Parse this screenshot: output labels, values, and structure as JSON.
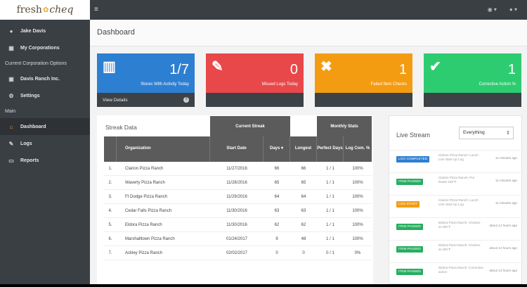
{
  "logo": {
    "fresh": "fresh",
    "cheq": "cheq"
  },
  "sidebar": {
    "user": "Jake Davis",
    "corporations": "My Corporations",
    "current_options": "Current Corporation Options",
    "corp_name": "Davis Ranch Inc.",
    "settings": "Settings",
    "main_section": "Main",
    "dashboard": "Dashboard",
    "logs": "Logs",
    "reports": "Reports"
  },
  "page": {
    "title": "Dashboard"
  },
  "cards": [
    {
      "value": "1/7",
      "label": "Stores With Activity Today",
      "footer": "View Details",
      "color": "#2d7fd1",
      "icon": "building-icon"
    },
    {
      "value": "0",
      "label": "Missed Logs Today",
      "footer": "",
      "color": "#e8484a",
      "icon": "edit-icon"
    },
    {
      "value": "1",
      "label": "Failed Item Checks",
      "footer": "",
      "color": "#f39c12",
      "icon": "times-icon"
    },
    {
      "value": "1",
      "label": "Corrective Action %",
      "footer": "",
      "color": "#2ecc71",
      "icon": "check-icon"
    }
  ],
  "streak": {
    "title": "Streak Data",
    "group_current": "Current Streak",
    "group_monthly": "Monthly Stats",
    "headers": {
      "organization": "Organization",
      "start_date": "Start Date",
      "days": "Days ▾",
      "longest": "Longest",
      "perfect_days": "Perfect Days",
      "log_com": "Log Com. %"
    },
    "rows": [
      {
        "n": "1.",
        "org": "Clarion Pizza Ranch",
        "start": "11/27/2016",
        "days": "66",
        "longest": "66",
        "perfect": "1 / 1",
        "pct": "100%"
      },
      {
        "n": "2.",
        "org": "Waverly Pizza Ranch",
        "start": "11/28/2016",
        "days": "65",
        "longest": "65",
        "perfect": "1 / 1",
        "pct": "100%"
      },
      {
        "n": "3.",
        "org": "Ft Dodge Pizza Ranch",
        "start": "11/29/2016",
        "days": "64",
        "longest": "64",
        "perfect": "1 / 1",
        "pct": "100%"
      },
      {
        "n": "4.",
        "org": "Cedar Falls Pizza Ranch",
        "start": "11/30/2016",
        "days": "63",
        "longest": "63",
        "perfect": "1 / 1",
        "pct": "100%"
      },
      {
        "n": "5.",
        "org": "Eldora Pizza Ranch",
        "start": "11/30/2016",
        "days": "62",
        "longest": "62",
        "perfect": "1 / 1",
        "pct": "100%"
      },
      {
        "n": "6.",
        "org": "Marshalltown Pizza Ranch",
        "start": "01/24/2017",
        "days": "9",
        "longest": "48",
        "perfect": "1 / 1",
        "pct": "100%"
      },
      {
        "n": "7.",
        "org": "Ackley Pizza Ranch",
        "start": "02/02/2017",
        "days": "0",
        "longest": "0",
        "perfect": "0 / 1",
        "pct": "0%"
      }
    ]
  },
  "live": {
    "title": "Live Stream",
    "filter": "Everything",
    "events": [
      {
        "badge": "LOG COMPLETED",
        "color": "#2d7fd1",
        "msg": "Clarion Pizza Ranch: Lunch Line Start Up Log",
        "time": "11 minutes ago"
      },
      {
        "badge": "ITEM PASSED",
        "color": "#27ae60",
        "msg": "Clarion Pizza Ranch: Pot Roast 165°F",
        "time": "11 minutes ago"
      },
      {
        "badge": "LOG START",
        "color": "#f39c12",
        "msg": "Clarion Pizza Ranch: Lunch Line Start Up Log",
        "time": "11 minutes ago"
      },
      {
        "badge": "ITEM PASSED",
        "color": "#27ae60",
        "msg": "Eldora Pizza Ranch: Chicken at 165°F",
        "time": "about 14 hours ago"
      },
      {
        "badge": "ITEM PASSED",
        "color": "#27ae60",
        "msg": "Eldora Pizza Ranch: Chicken at 165°F",
        "time": "about 14 hours ago"
      },
      {
        "badge": "ITEM PASSED",
        "color": "#27ae60",
        "msg": "Eldora Pizza Ranch: Corrective action",
        "time": "about 14 hours ago"
      }
    ]
  }
}
